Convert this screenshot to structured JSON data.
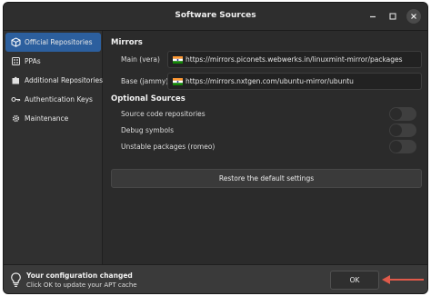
{
  "window": {
    "title": "Software Sources"
  },
  "sidebar": {
    "items": [
      {
        "label": "Official Repositories",
        "icon": "package-icon",
        "selected": true
      },
      {
        "label": "PPAs",
        "icon": "ppa-icon",
        "selected": false
      },
      {
        "label": "Additional Repositories",
        "icon": "puzzle-icon",
        "selected": false
      },
      {
        "label": "Authentication Keys",
        "icon": "key-icon",
        "selected": false
      },
      {
        "label": "Maintenance",
        "icon": "gear-icon",
        "selected": false
      }
    ]
  },
  "mirrors": {
    "heading": "Mirrors",
    "main_label": "Main (vera)",
    "main_url": "https://mirrors.piconets.webwerks.in/linuxmint-mirror/packages",
    "base_label": "Base (jammy)",
    "base_url": "https://mirrors.nxtgen.com/ubuntu-mirror/ubuntu",
    "flag": "india-flag-icon"
  },
  "optional": {
    "heading": "Optional Sources",
    "items": [
      {
        "label": "Source code repositories",
        "enabled": false
      },
      {
        "label": "Debug symbols",
        "enabled": false
      },
      {
        "label": "Unstable packages (romeo)",
        "enabled": false
      }
    ]
  },
  "restore_label": "Restore the default settings",
  "infobar": {
    "title": "Your configuration changed",
    "message": "Click OK to update your APT cache",
    "ok_label": "OK"
  },
  "colors": {
    "accent": "#2c5f9e",
    "arrow": "#e05a4a",
    "background": "#2b2b2b"
  }
}
